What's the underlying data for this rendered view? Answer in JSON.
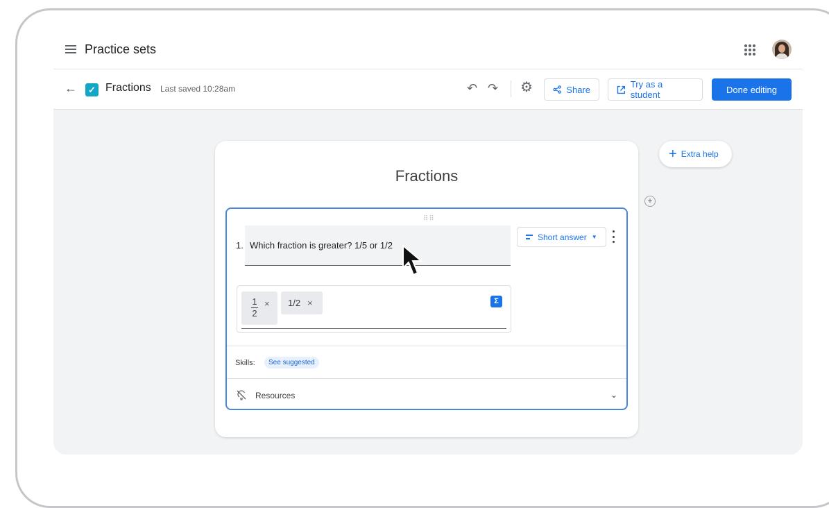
{
  "topbar": {
    "title": "Practice sets",
    "icons": [
      "menu-icon",
      "apps-grid-icon",
      "avatar"
    ]
  },
  "toolbar": {
    "doc_title": "Fractions",
    "last_saved": "Last saved 10:28am",
    "share_label": "Share",
    "try_label": "Try as a student",
    "done_label": "Done editing",
    "icons": [
      "back-arrow-icon",
      "checkbox-icon",
      "undo-icon",
      "redo-icon",
      "settings-gear-icon",
      "share-icon",
      "open-external-icon"
    ]
  },
  "card": {
    "title": "Fractions",
    "question": {
      "number": "1.",
      "text": "Which fraction is greater? 1/5 or 1/2",
      "type_label": "Short answer"
    },
    "answers": {
      "fraction_numerator": "1",
      "fraction_denominator": "2",
      "text_answer": "1/2",
      "remove_symbol": "×",
      "math_symbol": "Σ"
    },
    "skills": {
      "label": "Skills:",
      "badge": "See suggested"
    },
    "resources": {
      "label": "Resources"
    }
  },
  "side": {
    "extra_help_label": "Extra help",
    "add_symbol": "+"
  },
  "colors": {
    "accent": "#1a73e8",
    "question_border": "#4a86d9",
    "checkbox": "#12a7c7"
  }
}
